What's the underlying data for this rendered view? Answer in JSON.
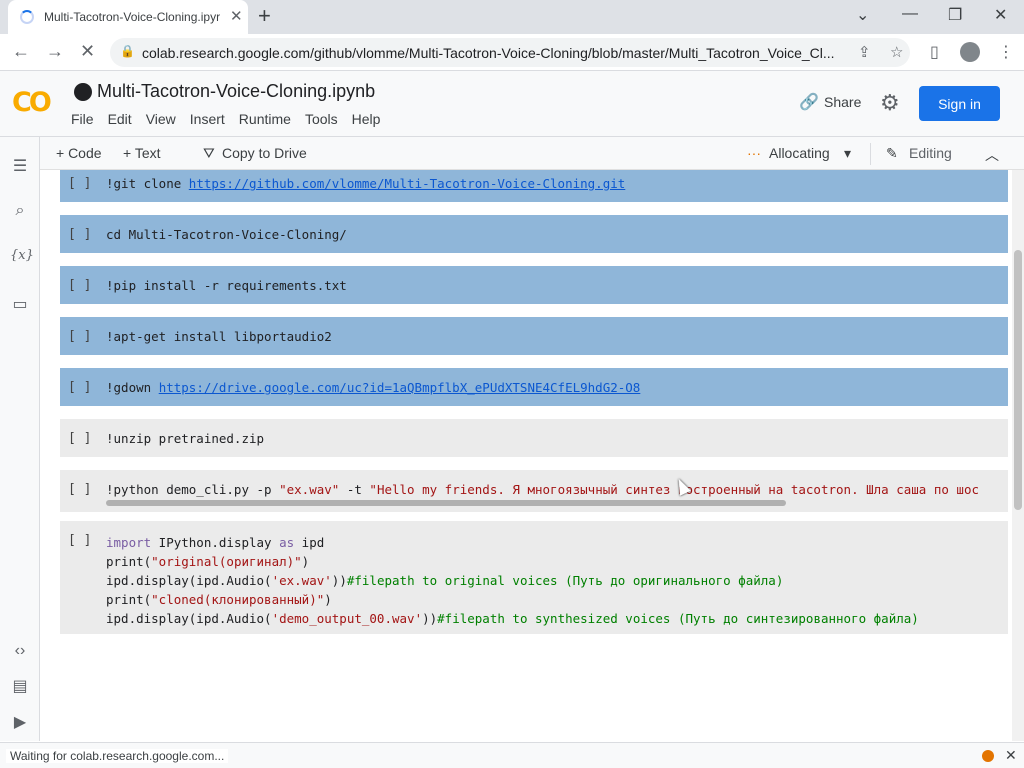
{
  "browser": {
    "tab_title": "Multi-Tacotron-Voice-Cloning.ipyr",
    "tab_close": "✕",
    "new_tab": "+",
    "minimize": "⌄",
    "min": "—",
    "restore": "❐",
    "close": "✕",
    "url": "colab.research.google.com/github/vlomme/Multi-Tacotron-Voice-Cloning/blob/master/Multi_Tacotron_Voice_Cl...",
    "back": "←",
    "forward": "→",
    "reload": "✕"
  },
  "colab": {
    "logo": "CO",
    "notebook_title": "Multi-Tacotron-Voice-Cloning.ipynb",
    "menu": [
      "File",
      "Edit",
      "View",
      "Insert",
      "Runtime",
      "Tools",
      "Help"
    ],
    "share": "Share",
    "sign_in": "Sign in",
    "toolbar": {
      "code": "+ Code",
      "text": "+ Text",
      "copy_to_drive": "Copy to Drive",
      "allocating": "Allocating",
      "editing": "Editing"
    }
  },
  "cells": [
    {
      "run": "[ ]",
      "segments": [
        [
          "t",
          "!git clone "
        ],
        [
          "link",
          "https://github.com/vlomme/Multi-Tacotron-Voice-Cloning.git"
        ]
      ]
    },
    {
      "run": "[ ]",
      "segments": [
        [
          "t",
          "cd Multi-Tacotron-Voice-Cloning/"
        ]
      ]
    },
    {
      "run": "[ ]",
      "segments": [
        [
          "t",
          "!pip install -r requirements.txt"
        ]
      ]
    },
    {
      "run": "[ ]",
      "segments": [
        [
          "t",
          "!apt-get install libportaudio2"
        ]
      ]
    },
    {
      "run": "[ ]",
      "segments": [
        [
          "t",
          "!gdown "
        ],
        [
          "link",
          "https://drive.google.com/uc?id=1aQBmpflbX_ePUdXTSNE4CfEL9hdG2-O8"
        ]
      ]
    },
    {
      "run": "[ ]",
      "segments": [
        [
          "t",
          "!unzip pretrained.zip"
        ]
      ]
    },
    {
      "run": "[ ]",
      "segments": [
        [
          "t",
          "!python demo_cli.py -p "
        ],
        [
          "str",
          "\"ex.wav\""
        ],
        [
          "t",
          " -t "
        ],
        [
          "str",
          "\"Hello my friends. Я многоязычный синтез построенный на tacotron. Шла саша по шос"
        ]
      ]
    },
    {
      "run": "[ ]",
      "lines": [
        [
          [
            "kw",
            "import"
          ],
          [
            "t",
            " IPython.display "
          ],
          [
            "kw",
            "as"
          ],
          [
            "t",
            " ipd"
          ]
        ],
        [
          [
            "t",
            "print("
          ],
          [
            "str",
            "\"original(оригинал)\""
          ],
          [
            "t",
            ")"
          ]
        ],
        [
          [
            "t",
            "ipd.display(ipd.Audio("
          ],
          [
            "str",
            "'ex.wav'"
          ],
          [
            "t",
            "))"
          ],
          [
            "cmt",
            "#filepath to original voices (Путь до оригинального файла)"
          ]
        ],
        [
          [
            "t",
            "print("
          ],
          [
            "str",
            "\"cloned(клонированный)\""
          ],
          [
            "t",
            ")"
          ]
        ],
        [
          [
            "t",
            "ipd.display(ipd.Audio("
          ],
          [
            "str",
            "'demo_output_00.wav'"
          ],
          [
            "t",
            "))"
          ],
          [
            "cmt",
            "#filepath to synthesized voices (Путь до синтезированного файла)"
          ]
        ]
      ]
    }
  ],
  "status": {
    "text": "Waiting for colab.research.google.com..."
  },
  "colors": {
    "selected_cell": "#8fb6d9",
    "cell": "#ebebeb",
    "sign_in": "#1a73e8",
    "logo": "#f9ab00"
  }
}
